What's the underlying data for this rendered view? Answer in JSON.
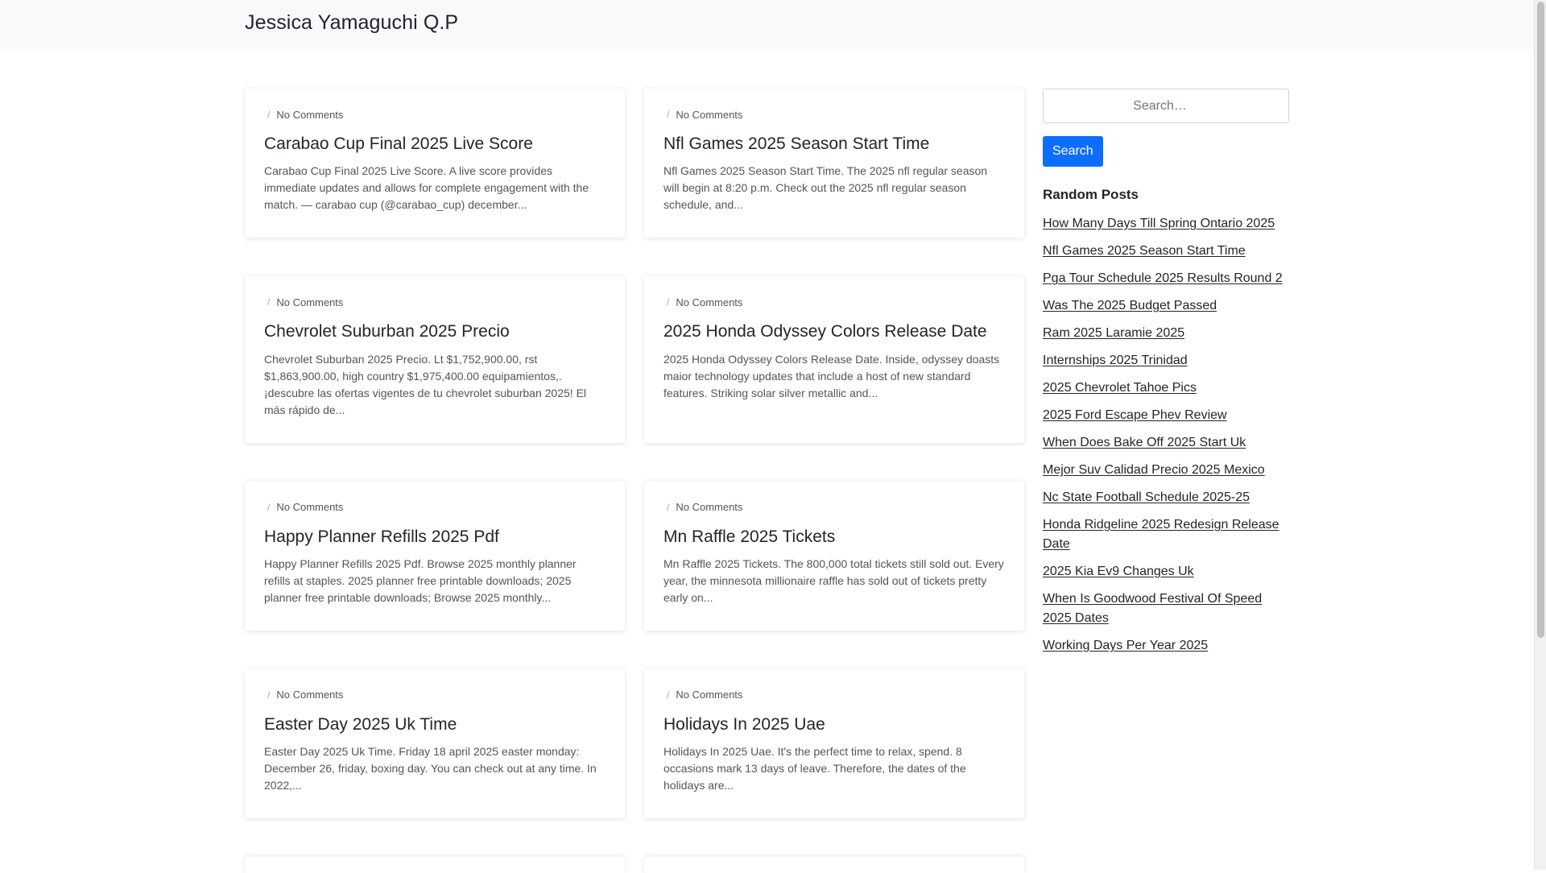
{
  "site": {
    "title": "Jessica Yamaguchi Q.P"
  },
  "posts": [
    {
      "meta": "No Comments",
      "title": "Carabao Cup Final 2025 Live Score",
      "excerpt": "Carabao Cup Final 2025 Live Score. A live score provides immediate updates and allows for complete engagement with the match. — carabao cup (@carabao_cup) december..."
    },
    {
      "meta": "No Comments",
      "title": "Nfl Games 2025 Season Start Time",
      "excerpt": "Nfl Games 2025 Season Start Time. The 2025 nfl regular season will begin at 8:20 p.m. Check out the 2025 nfl regular season schedule, and..."
    },
    {
      "meta": "No Comments",
      "title": "Chevrolet Suburban 2025 Precio",
      "excerpt": "Chevrolet Suburban 2025 Precio. Lt $1,752,900.00, rst $1,863,900.00, high country $1,975,400.00 equipamientos,. ¡descubre las ofertas vigentes de tu chevrolet suburban 2025! El más rápido de..."
    },
    {
      "meta": "No Comments",
      "title": "2025 Honda Odyssey Colors Release Date",
      "excerpt": "2025 Honda Odyssey Colors Release Date. Inside, odyssey doasts maior technology updates that include a host of new standard features. Striking solar silver metallic and..."
    },
    {
      "meta": "No Comments",
      "title": "Happy Planner Refills 2025 Pdf",
      "excerpt": "Happy Planner Refills 2025 Pdf. Browse 2025 monthly planner refills at staples. 2025 planner free printable downloads; 2025 planner free printable downloads; Browse 2025 monthly..."
    },
    {
      "meta": "No Comments",
      "title": "Mn Raffle 2025 Tickets",
      "excerpt": "Mn Raffle 2025 Tickets. The 800,000 total tickets still sold out. Every year, the minnesota millionaire raffle has sold out of tickets pretty early on..."
    },
    {
      "meta": "No Comments",
      "title": "Easter Day 2025 Uk Time",
      "excerpt": "Easter Day 2025 Uk Time. Friday 18 april 2025 easter monday: December 26, friday, boxing day. You can check out at any time. In 2022,..."
    },
    {
      "meta": "No Comments",
      "title": "Holidays In 2025 Uae",
      "excerpt": "Holidays In 2025 Uae. It's the perfect time to relax, spend. 8 occasions mark 13 days of leave. Therefore, the dates of the holidays are..."
    }
  ],
  "search": {
    "placeholder": "Search…",
    "button_label": "Search"
  },
  "random_posts": {
    "heading": "Random Posts",
    "items": [
      "How Many Days Till Spring Ontario 2025",
      "Nfl Games 2025 Season Start Time",
      "Pga Tour Schedule 2025 Results Round 2",
      "Was The 2025 Budget Passed",
      "Ram 2025 Laramie 2025",
      "Internships 2025 Trinidad",
      "2025 Chevrolet Tahoe Pics",
      "2025 Ford Escape Phev Review",
      "When Does Bake Off 2025 Start Uk",
      "Mejor Suv Calidad Precio 2025 Mexico",
      "Nc State Football Schedule 2025-25",
      "Honda Ridgeline 2025 Redesign Release Date",
      "2025 Kia Ev9 Changes Uk",
      "When Is Goodwood Festival Of Speed 2025 Dates",
      "Working Days Per Year 2025"
    ]
  },
  "colors": {
    "accent": "#0d6efd",
    "topbar": "#f8f9fa"
  }
}
